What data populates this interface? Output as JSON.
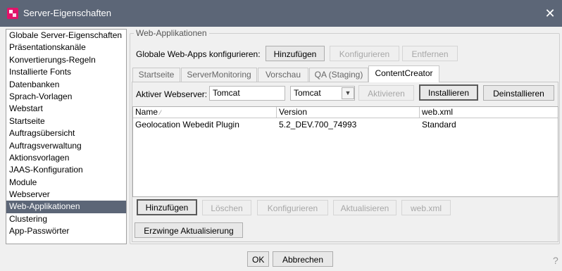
{
  "window": {
    "title": "Server-Eigenschaften"
  },
  "sidebar": {
    "items": [
      "Globale Server-Eigenschaften",
      "Präsentationskanäle",
      "Konvertierungs-Regeln",
      "Installierte Fonts",
      "Datenbanken",
      "Sprach-Vorlagen",
      "Webstart",
      "Startseite",
      "Auftragsübersicht",
      "Auftragsverwaltung",
      "Aktionsvorlagen",
      "JAAS-Konfiguration",
      "Module",
      "Webserver",
      "Web-Applikationen",
      "Clustering",
      "App-Passwörter"
    ],
    "selected": "Web-Applikationen"
  },
  "main": {
    "group_title": "Web-Applikationen",
    "global": {
      "label": "Globale Web-Apps konfigurieren:",
      "add": "Hinzufügen",
      "configure": "Konfigurieren",
      "remove": "Entfernen"
    },
    "tabs": [
      "Startseite",
      "ServerMonitoring",
      "Vorschau",
      "QA (Staging)",
      "ContentCreator"
    ],
    "active_tab": "ContentCreator",
    "webserver": {
      "label": "Aktiver Webserver:",
      "value": "Tomcat",
      "select_value": "Tomcat",
      "activate": "Aktivieren",
      "install": "Installieren",
      "uninstall": "Deinstallieren"
    },
    "table": {
      "columns": [
        "Name",
        "Version",
        "web.xml"
      ],
      "rows": [
        [
          "Geolocation Webedit Plugin",
          "5.2_DEV.700_74993",
          "Standard"
        ]
      ]
    },
    "actions": {
      "add": "Hinzufügen",
      "delete": "Löschen",
      "configure": "Konfigurieren",
      "update": "Aktualisieren",
      "webxml": "web.xml"
    },
    "force_update": "Erzwinge Aktualisierung"
  },
  "footer": {
    "ok": "OK",
    "cancel": "Abbrechen",
    "edge_glyph": "?"
  }
}
